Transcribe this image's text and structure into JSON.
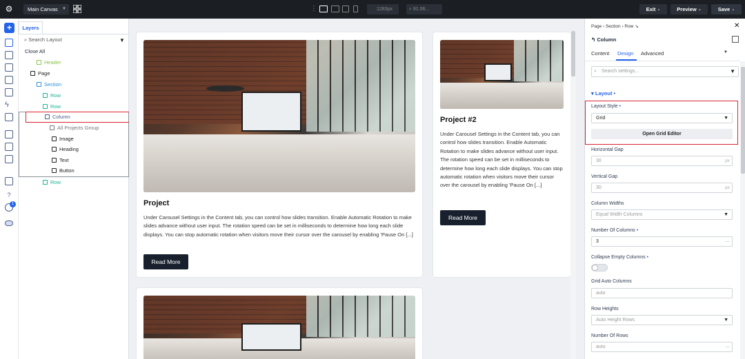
{
  "topbar": {
    "canvas_select": "Main Canvas",
    "width_value": "1283px",
    "zoom_value": "91.06...",
    "exit_label": "Exit",
    "preview_label": "Preview",
    "save_label": "Save"
  },
  "left_rail": {
    "icons": [
      "plus-icon",
      "layers-icon",
      "pages-icon",
      "database-icon",
      "comments-icon",
      "templates-icon",
      "lightning-icon",
      "settings-sliders-icon",
      "hierarchy-icon",
      "component-icon",
      "settings-icon",
      "stack-icon",
      "help-icon",
      "notifications-icon",
      "toggle-icon"
    ],
    "notification_count": "1"
  },
  "layers": {
    "tab_label": "Layers",
    "search_placeholder": "Search Layout",
    "close_all": "Close All",
    "items": [
      {
        "label": "Header",
        "color": "#8bc34a"
      },
      {
        "label": "Page",
        "color": "#222222"
      },
      {
        "label": "Section",
        "color": "#2f8fd6"
      },
      {
        "label": "Row",
        "color": "#19b394"
      },
      {
        "label": "Row",
        "color": "#19b394"
      },
      {
        "label": "Column",
        "color": "#4b5f8a"
      },
      {
        "label": "All Projects Group",
        "color": "#777777"
      },
      {
        "label": "Image",
        "color": "#222222"
      },
      {
        "label": "Heading",
        "color": "#222222"
      },
      {
        "label": "Text",
        "color": "#222222"
      },
      {
        "label": "Button",
        "color": "#222222"
      },
      {
        "label": "Row",
        "color": "#19b394"
      }
    ]
  },
  "canvas": {
    "card1": {
      "title": "Project",
      "body": "Under Carousel Settings in the Content tab, you can control how slides transition. Enable Automatic Rotation to make slides advance without user input. The rotation speed can be set in milliseconds to determine how long each slide displays. You can stop automatic rotation when visitors move their cursor over the carousel by enabling 'Pause On [...]",
      "button": "Read More"
    },
    "card2": {
      "title": "Project #2",
      "body": "Under Carousel Settings in the Content tab, you can control how slides transition. Enable Automatic Rotation to make slides advance without user input. The rotation speed can be set in milliseconds to determine how long each slide displays. You can stop automatic rotation when visitors move their cursor over the carousel by enabling 'Pause On [...]",
      "button": "Read More"
    }
  },
  "panel": {
    "breadcrumb": "Page  ›  Section  ›  Row  ↘",
    "element_title": "Column",
    "tabs": [
      "Content",
      "Design",
      "Advanced"
    ],
    "active_tab": "Design",
    "search_placeholder": "Search settings...",
    "section_title": "Layout",
    "layout_style_label": "Layout Style",
    "layout_style_value": "Grid",
    "grid_editor_button": "Open Grid Editor",
    "horizontal_gap_label": "Horizontal Gap",
    "horizontal_gap_value": "30",
    "vertical_gap_label": "Vertical Gap",
    "vertical_gap_value": "30",
    "unit": "px",
    "column_widths_label": "Column Widths",
    "column_widths_value": "Equal Width Columns",
    "num_columns_label": "Number Of Columns",
    "num_columns_value": "3",
    "collapse_label": "Collapse Empty Columns",
    "grid_auto_label": "Grid Auto Columns",
    "grid_auto_value": "auto",
    "row_heights_label": "Row Heights",
    "row_heights_value": "Auto Height Rows",
    "num_rows_label": "Number Of Rows",
    "num_rows_value": "auto"
  }
}
